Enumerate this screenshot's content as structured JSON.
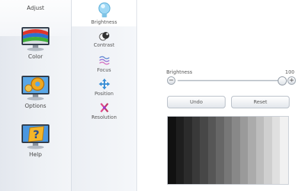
{
  "categories": [
    {
      "id": "adjust",
      "label": "Adjust",
      "icon": "adjust-monitor-icon",
      "active": true
    },
    {
      "id": "color",
      "label": "Color",
      "icon": "color-monitor-icon",
      "active": false
    },
    {
      "id": "options",
      "label": "Options",
      "icon": "options-monitor-icon",
      "active": false
    },
    {
      "id": "help",
      "label": "Help",
      "icon": "help-monitor-icon",
      "active": false
    }
  ],
  "subitems": [
    {
      "id": "brightness",
      "label": "Brightness",
      "icon": "lightbulb-icon",
      "active": true
    },
    {
      "id": "contrast",
      "label": "Contrast",
      "icon": "contrast-icon",
      "active": false
    },
    {
      "id": "focus",
      "label": "Focus",
      "icon": "focus-waves-icon",
      "active": false
    },
    {
      "id": "position",
      "label": "Position",
      "icon": "position-arrows-icon",
      "active": false
    },
    {
      "id": "resolution",
      "label": "Resolution",
      "icon": "resolution-icon",
      "active": false
    }
  ],
  "brightness": {
    "label": "Brightness",
    "value": "100",
    "level": 1.0,
    "minus": "−",
    "plus": "+"
  },
  "buttons": {
    "undo": "Undo",
    "reset": "Reset"
  },
  "grayscale": [
    "#111111",
    "#1e1e1e",
    "#2b2b2b",
    "#393939",
    "#474747",
    "#565656",
    "#666666",
    "#777777",
    "#888888",
    "#9a9a9a",
    "#ababab",
    "#bdbdbd",
    "#cfcfcf",
    "#e0e0e0",
    "#f1f1f1"
  ],
  "colors": {
    "accent": "#4a90d9"
  }
}
